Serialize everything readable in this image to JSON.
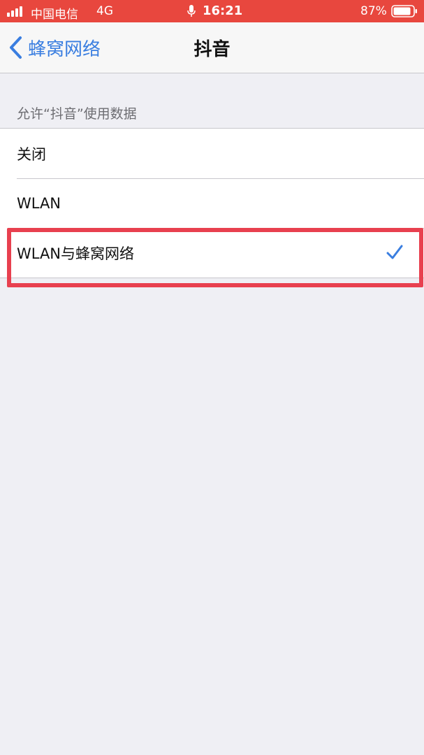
{
  "status_bar": {
    "carrier": "中国电信",
    "network": "4G",
    "time": "16:21",
    "battery": "87%",
    "background_color": "#e8473e"
  },
  "nav": {
    "back_label": "蜂窝网络",
    "title": "抖音",
    "accent_color": "#3a7ee0"
  },
  "section": {
    "header": "允许“抖音”使用数据"
  },
  "options": [
    {
      "label": "关闭",
      "selected": false
    },
    {
      "label": "WLAN",
      "selected": false
    },
    {
      "label": "WLAN与蜂窝网络",
      "selected": true
    }
  ],
  "highlight": {
    "color": "#e8404f"
  },
  "icons": {
    "signal": "signal-bars-icon",
    "mic": "microphone-icon",
    "battery": "battery-icon",
    "back": "chevron-left-icon",
    "check": "checkmark-icon"
  }
}
